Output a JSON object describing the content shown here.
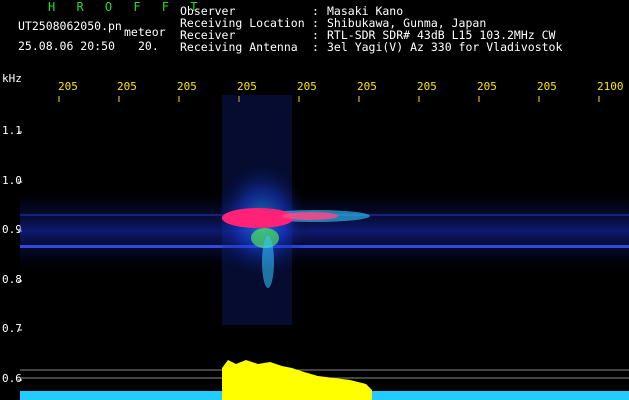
{
  "header": {
    "app_title": "H R O F F T",
    "filename": "UT2508062050.pn",
    "meteor_label": "meteor",
    "datetime": "25.08.06 20:50",
    "count": "20.",
    "info": [
      {
        "label": "Observer",
        "value": "Masaki Kano"
      },
      {
        "label": "Receiving Location",
        "value": "Shibukawa, Gunma, Japan"
      },
      {
        "label": "Receiver",
        "value": "RTL-SDR SDR# 43dB L15 103.2MHz CW"
      },
      {
        "label": "Receiving Antenna",
        "value": "3el Yagi(V) Az 330 for Vladivostok"
      }
    ]
  },
  "axis": {
    "y_unit": "kHz",
    "y_ticks": [
      "1.1",
      "1.0",
      "0.9",
      "0.8",
      "0.7",
      "0.6"
    ],
    "x_ticks": [
      "205",
      "205",
      "205",
      "205",
      "205",
      "205",
      "205",
      "205",
      "205",
      "2100"
    ]
  },
  "colors": {
    "background": "#000000",
    "title_green": "#22dd22",
    "axis_yellow": "#ffe600",
    "signal_magenta": "#ff2277",
    "signal_blue": "#2244ff",
    "level_yellow": "#ffff00",
    "level_cyan": "#22ccff"
  }
}
